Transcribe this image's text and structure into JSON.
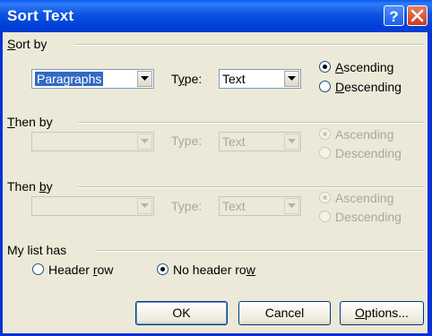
{
  "window": {
    "title": "Sort Text",
    "help_label": "?",
    "close_label": "X"
  },
  "sort_by": {
    "label_pre": "",
    "label_u": "S",
    "label_post": "ort by",
    "field": "Paragraphs",
    "type_pre": "T",
    "type_u": "y",
    "type_post": "pe:",
    "type_value": "Text",
    "ascending_pre": "",
    "ascending_u": "A",
    "ascending_post": "scending",
    "descending_pre": "",
    "descending_u": "D",
    "descending_post": "escending",
    "order": "Ascending"
  },
  "then_by_1": {
    "label_pre": "",
    "label_u": "T",
    "label_post": "hen by",
    "field": "",
    "type_label": "Type:",
    "type_value": "Text",
    "ascending": "Ascending",
    "descending": "Descending"
  },
  "then_by_2": {
    "label_pre": "Then ",
    "label_u": "b",
    "label_post": "y",
    "field": "",
    "type_label": "Type:",
    "type_value": "Text",
    "ascending": "Ascending",
    "descending": "Descending"
  },
  "my_list": {
    "label": "My list has",
    "header_row_pre": "Header ",
    "header_row_u": "r",
    "header_row_post": "ow",
    "no_header_row_pre": "No header ro",
    "no_header_row_u": "w",
    "no_header_row_post": "",
    "selected": "No header row"
  },
  "buttons": {
    "ok": "OK",
    "cancel": "Cancel",
    "options_pre": "",
    "options_u": "O",
    "options_post": "ptions..."
  },
  "colors": {
    "titlebar": "#0054e3",
    "dialog_bg": "#ece9d8",
    "selection": "#316ac5",
    "radio_dot": "#21a121"
  }
}
